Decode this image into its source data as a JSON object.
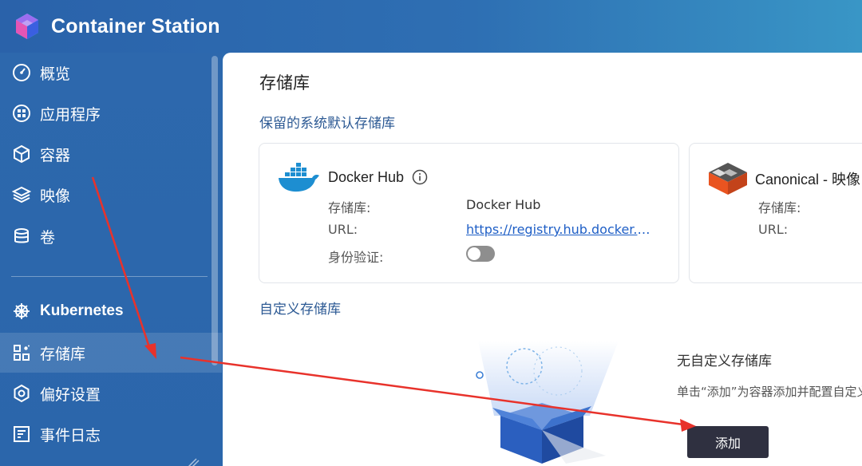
{
  "app": {
    "title": "Container Station"
  },
  "sidebar": {
    "items": [
      {
        "label": "概览",
        "icon": "gauge-icon"
      },
      {
        "label": "应用程序",
        "icon": "apps-icon"
      },
      {
        "label": "容器",
        "icon": "cube-icon"
      },
      {
        "label": "映像",
        "icon": "layers-icon"
      },
      {
        "label": "卷",
        "icon": "database-icon"
      },
      {
        "label": "Kubernetes",
        "icon": "helm-icon"
      },
      {
        "label": "存储库",
        "icon": "registry-icon",
        "active": true
      },
      {
        "label": "偏好设置",
        "icon": "settings-icon"
      },
      {
        "label": "事件日志",
        "icon": "log-icon"
      }
    ]
  },
  "main": {
    "title": "存储库",
    "reserved_section": "保留的系统默认存储库",
    "cards": [
      {
        "name": "Docker Hub",
        "repo_label": "存储库:",
        "repo_value": "Docker Hub",
        "url_label": "URL:",
        "url_value": "https://registry.hub.docker.com",
        "auth_label": "身份验证:",
        "auth_enabled": false
      },
      {
        "name": "Canonical - 映像",
        "repo_label": "存储库:",
        "url_label": "URL:"
      }
    ],
    "custom_section": "自定义存储库",
    "empty": {
      "title": "无自定义存储库",
      "desc": "单击“添加”为容器添加并配置自定义存储库。",
      "add_label": "添加"
    }
  },
  "colors": {
    "sidebar_bg": "#2b66ab",
    "accent_link": "#1f5fc6",
    "section_title": "#2d5a94",
    "add_button_bg": "#2f3040",
    "arrow": "#e8322b"
  }
}
